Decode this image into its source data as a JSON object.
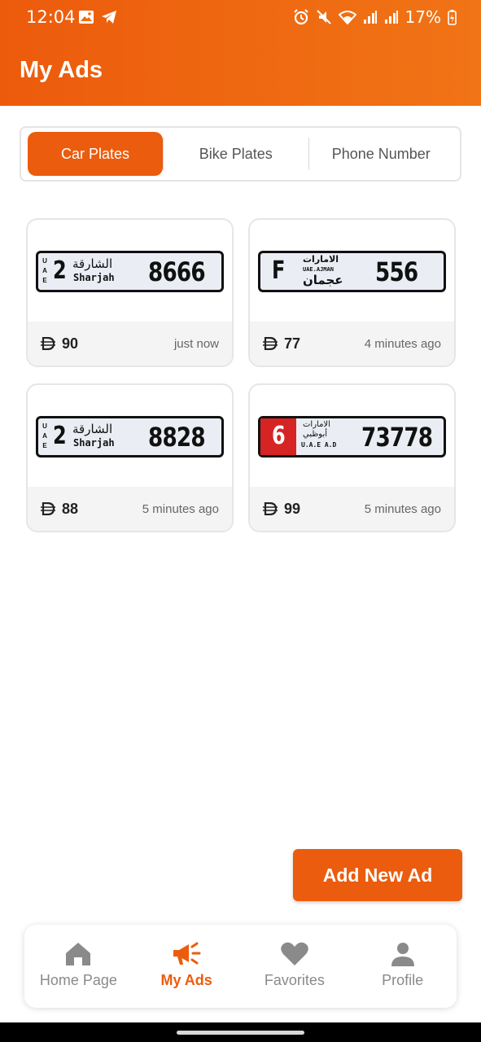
{
  "status_bar": {
    "time": "12:04",
    "battery": "17%",
    "left_icons": [
      "gallery-icon",
      "telegram-icon"
    ],
    "right_icons": [
      "alarm-icon",
      "mute-icon",
      "wifi-icon",
      "signal-icon",
      "signal-icon",
      "battery-charging-icon"
    ]
  },
  "header": {
    "title": "My Ads",
    "color": "#ec5b0c"
  },
  "tabs": [
    {
      "label": "Car Plates",
      "active": true
    },
    {
      "label": "Bike Plates",
      "active": false
    },
    {
      "label": "Phone Number",
      "active": false
    }
  ],
  "ads": [
    {
      "price": "90",
      "time": "just now",
      "plate": {
        "emirate_ar": "الشارقة",
        "emirate_en": "Sharjah",
        "code": "2",
        "number": "8666",
        "uae": [
          "U",
          "A",
          "E"
        ]
      }
    },
    {
      "price": "77",
      "time": "4 minutes ago",
      "plate": {
        "emirate_ar_top": "الامارات",
        "emirate_en": "UAE.AJMAN",
        "emirate_ar": "عجمان",
        "code": "F",
        "number": "556"
      }
    },
    {
      "price": "88",
      "time": "5 minutes ago",
      "plate": {
        "emirate_ar": "الشارقة",
        "emirate_en": "Sharjah",
        "code": "2",
        "number": "8828",
        "uae": [
          "U",
          "A",
          "E"
        ]
      }
    },
    {
      "price": "99",
      "time": "5 minutes ago",
      "plate": {
        "emirate_ar_top": "الامارات",
        "emirate_ar": "أبوظبي",
        "emirate_en": "U.A.E A.D",
        "code": "6",
        "number": "73778",
        "code_bg": "#d62424"
      }
    }
  ],
  "add_button": {
    "label": "Add New Ad"
  },
  "bottom_nav": [
    {
      "label": "Home Page",
      "icon": "home-icon",
      "active": false
    },
    {
      "label": "My Ads",
      "icon": "megaphone-icon",
      "active": true
    },
    {
      "label": "Favorites",
      "icon": "heart-icon",
      "active": false
    },
    {
      "label": "Profile",
      "icon": "person-icon",
      "active": false
    }
  ],
  "colors": {
    "accent": "#eb5c0e",
    "inactive": "#8a8a8a"
  }
}
